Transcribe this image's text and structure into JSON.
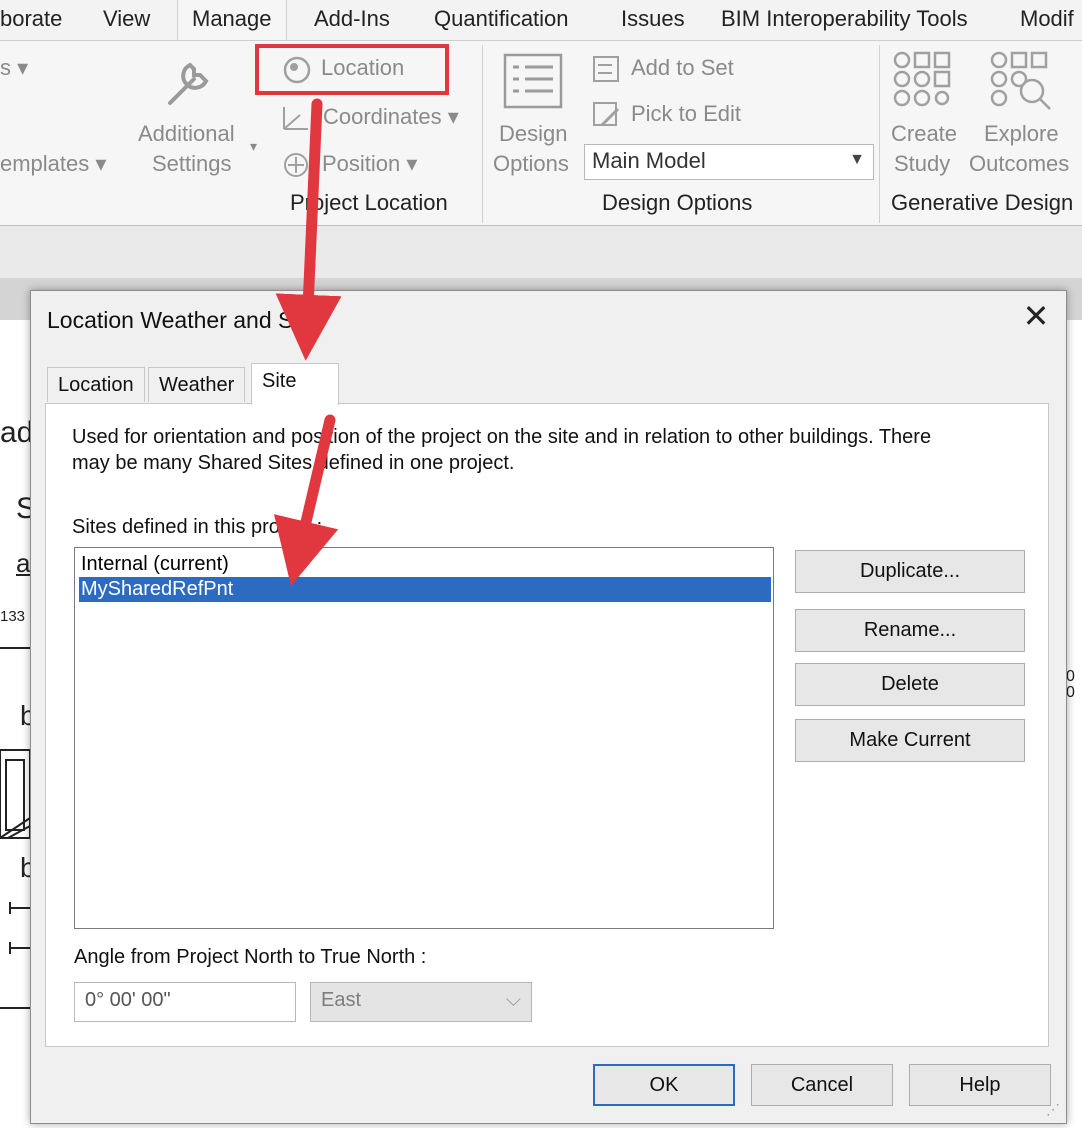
{
  "ribbon": {
    "tabs": [
      "borate",
      "View",
      "Manage",
      "Add-Ins",
      "Quantification",
      "Issues",
      "BIM Interoperability Tools",
      "Modif"
    ],
    "active_tab": "Manage",
    "items": {
      "left_dropdown": "s",
      "templates": "emplates",
      "additional_line1": "Additional",
      "additional_line2": "Settings",
      "location": "Location",
      "coordinates": "Coordinates",
      "position": "Position",
      "design_line1": "Design",
      "design_line2": "Options",
      "add_to_set": "Add to Set",
      "pick_to_edit": "Pick to Edit",
      "main_model": "Main Model",
      "create_line1": "Create",
      "create_line2": "Study",
      "explore_line1": "Explore",
      "explore_line2": "Outcomes"
    },
    "panels": {
      "project_location": "Project Location",
      "design_options": "Design Options",
      "generative_design": "Generative Design"
    }
  },
  "background_fragments": {
    "ad": "ad",
    "s": "S",
    "a": "a",
    "n133": "133",
    "b1": "b",
    "b2": "b",
    "r1": "0",
    "r2": "0"
  },
  "dialog": {
    "title": "Location Weather and Site",
    "tabs": [
      "Location",
      "Weather",
      "Site"
    ],
    "selected_tab": "Site",
    "description_line1": "Used for orientation and position of the project on the site and in relation to other buildings. There",
    "description_line2": "may be many Shared Sites defined in one project.",
    "sites_label": "Sites defined in this project :",
    "sites": [
      "Internal (current)",
      "MySharedRefPnt"
    ],
    "selected_site": "MySharedRefPnt",
    "buttons": {
      "duplicate": "Duplicate...",
      "rename": "Rename...",
      "delete": "Delete",
      "make_current": "Make Current",
      "ok": "OK",
      "cancel": "Cancel",
      "help": "Help"
    },
    "angle_label": "Angle from Project North to True North :",
    "angle_value": "0° 00' 00\"",
    "direction_value": "East"
  },
  "colors": {
    "annotation_red": "#e0383e",
    "selection_blue": "#2c6bbf"
  }
}
